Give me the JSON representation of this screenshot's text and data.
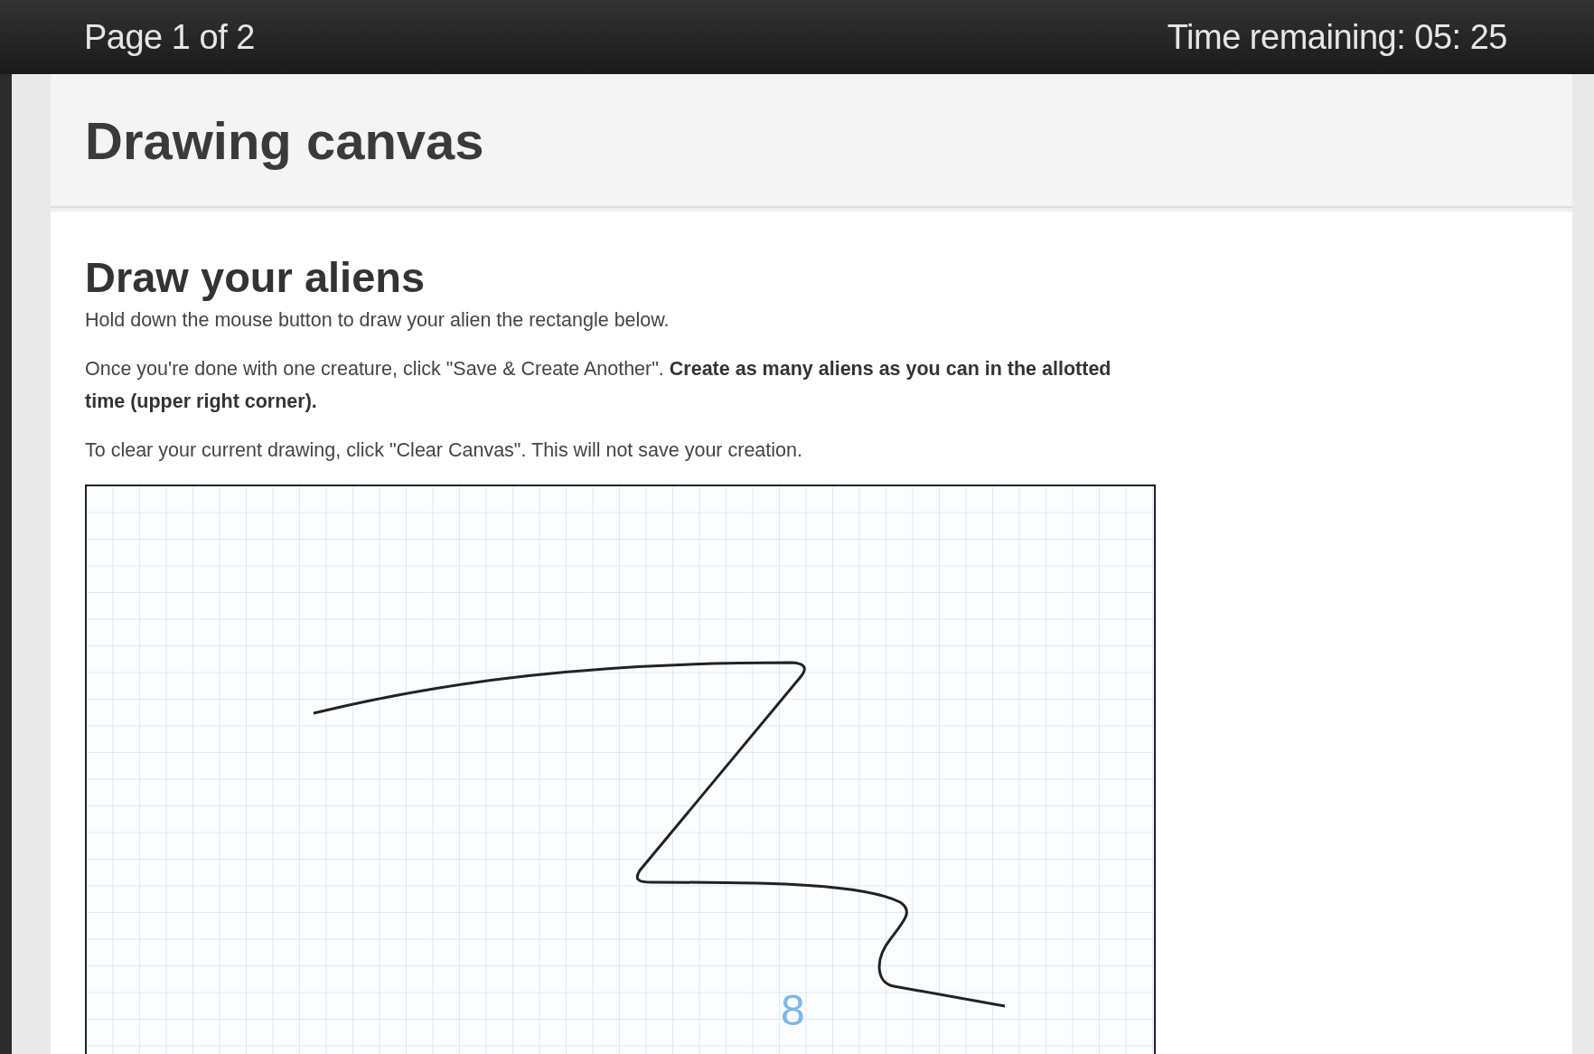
{
  "top_bar": {
    "page_indicator": "Page 1 of 2",
    "timer": "Time remaining: 05: 25"
  },
  "header": {
    "title": "Drawing canvas"
  },
  "section": {
    "heading": "Draw your aliens",
    "paragraphs": [
      "Hold down the mouse button to draw your alien the rectangle below.",
      "Once you're done with one creature, click \"Save & Create Another\". **Create as many aliens as you can in the allotted time (upper right corner).**",
      "To clear your current drawing, click \"Clear Canvas\". This will not save your creation."
    ]
  },
  "canvas": {
    "mark": "8"
  }
}
